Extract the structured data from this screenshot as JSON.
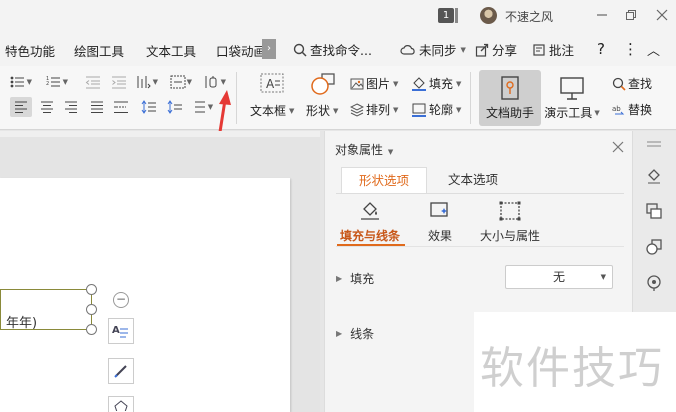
{
  "titlebar": {
    "badge": "1",
    "user_name": "不速之风",
    "controls": [
      "minimize",
      "restore",
      "close"
    ]
  },
  "tabs": [
    {
      "label": "特色功能"
    },
    {
      "label": "绘图工具"
    },
    {
      "label": "文本工具"
    },
    {
      "label": "口袋动画"
    }
  ],
  "tab_more": "›",
  "right_tools": {
    "search": "查找命令...",
    "sync": "未同步",
    "share": "分享",
    "comment": "批注",
    "help": "?",
    "more": "⋮",
    "collapse": "︿"
  },
  "ribbon": {
    "textbox": "文本框",
    "shape": "形状",
    "picture": "图片",
    "arrange": "排列",
    "fill": "填充",
    "outline": "轮廓",
    "doc_helper": "文档助手",
    "present_tool": "演示工具",
    "find": "查找",
    "replace": "替换"
  },
  "canvas": {
    "textbox_text": "年年)"
  },
  "panel": {
    "title": "对象属性",
    "tabs": [
      "形状选项",
      "文本选项"
    ],
    "subtabs": [
      "填充与线条",
      "效果",
      "大小与属性"
    ],
    "fill_label": "填充",
    "fill_value": "无",
    "line_label": "线条"
  },
  "watermark": "软件技巧",
  "colors": {
    "accent": "#e06a1c",
    "annotation_arrow": "#e53935"
  }
}
